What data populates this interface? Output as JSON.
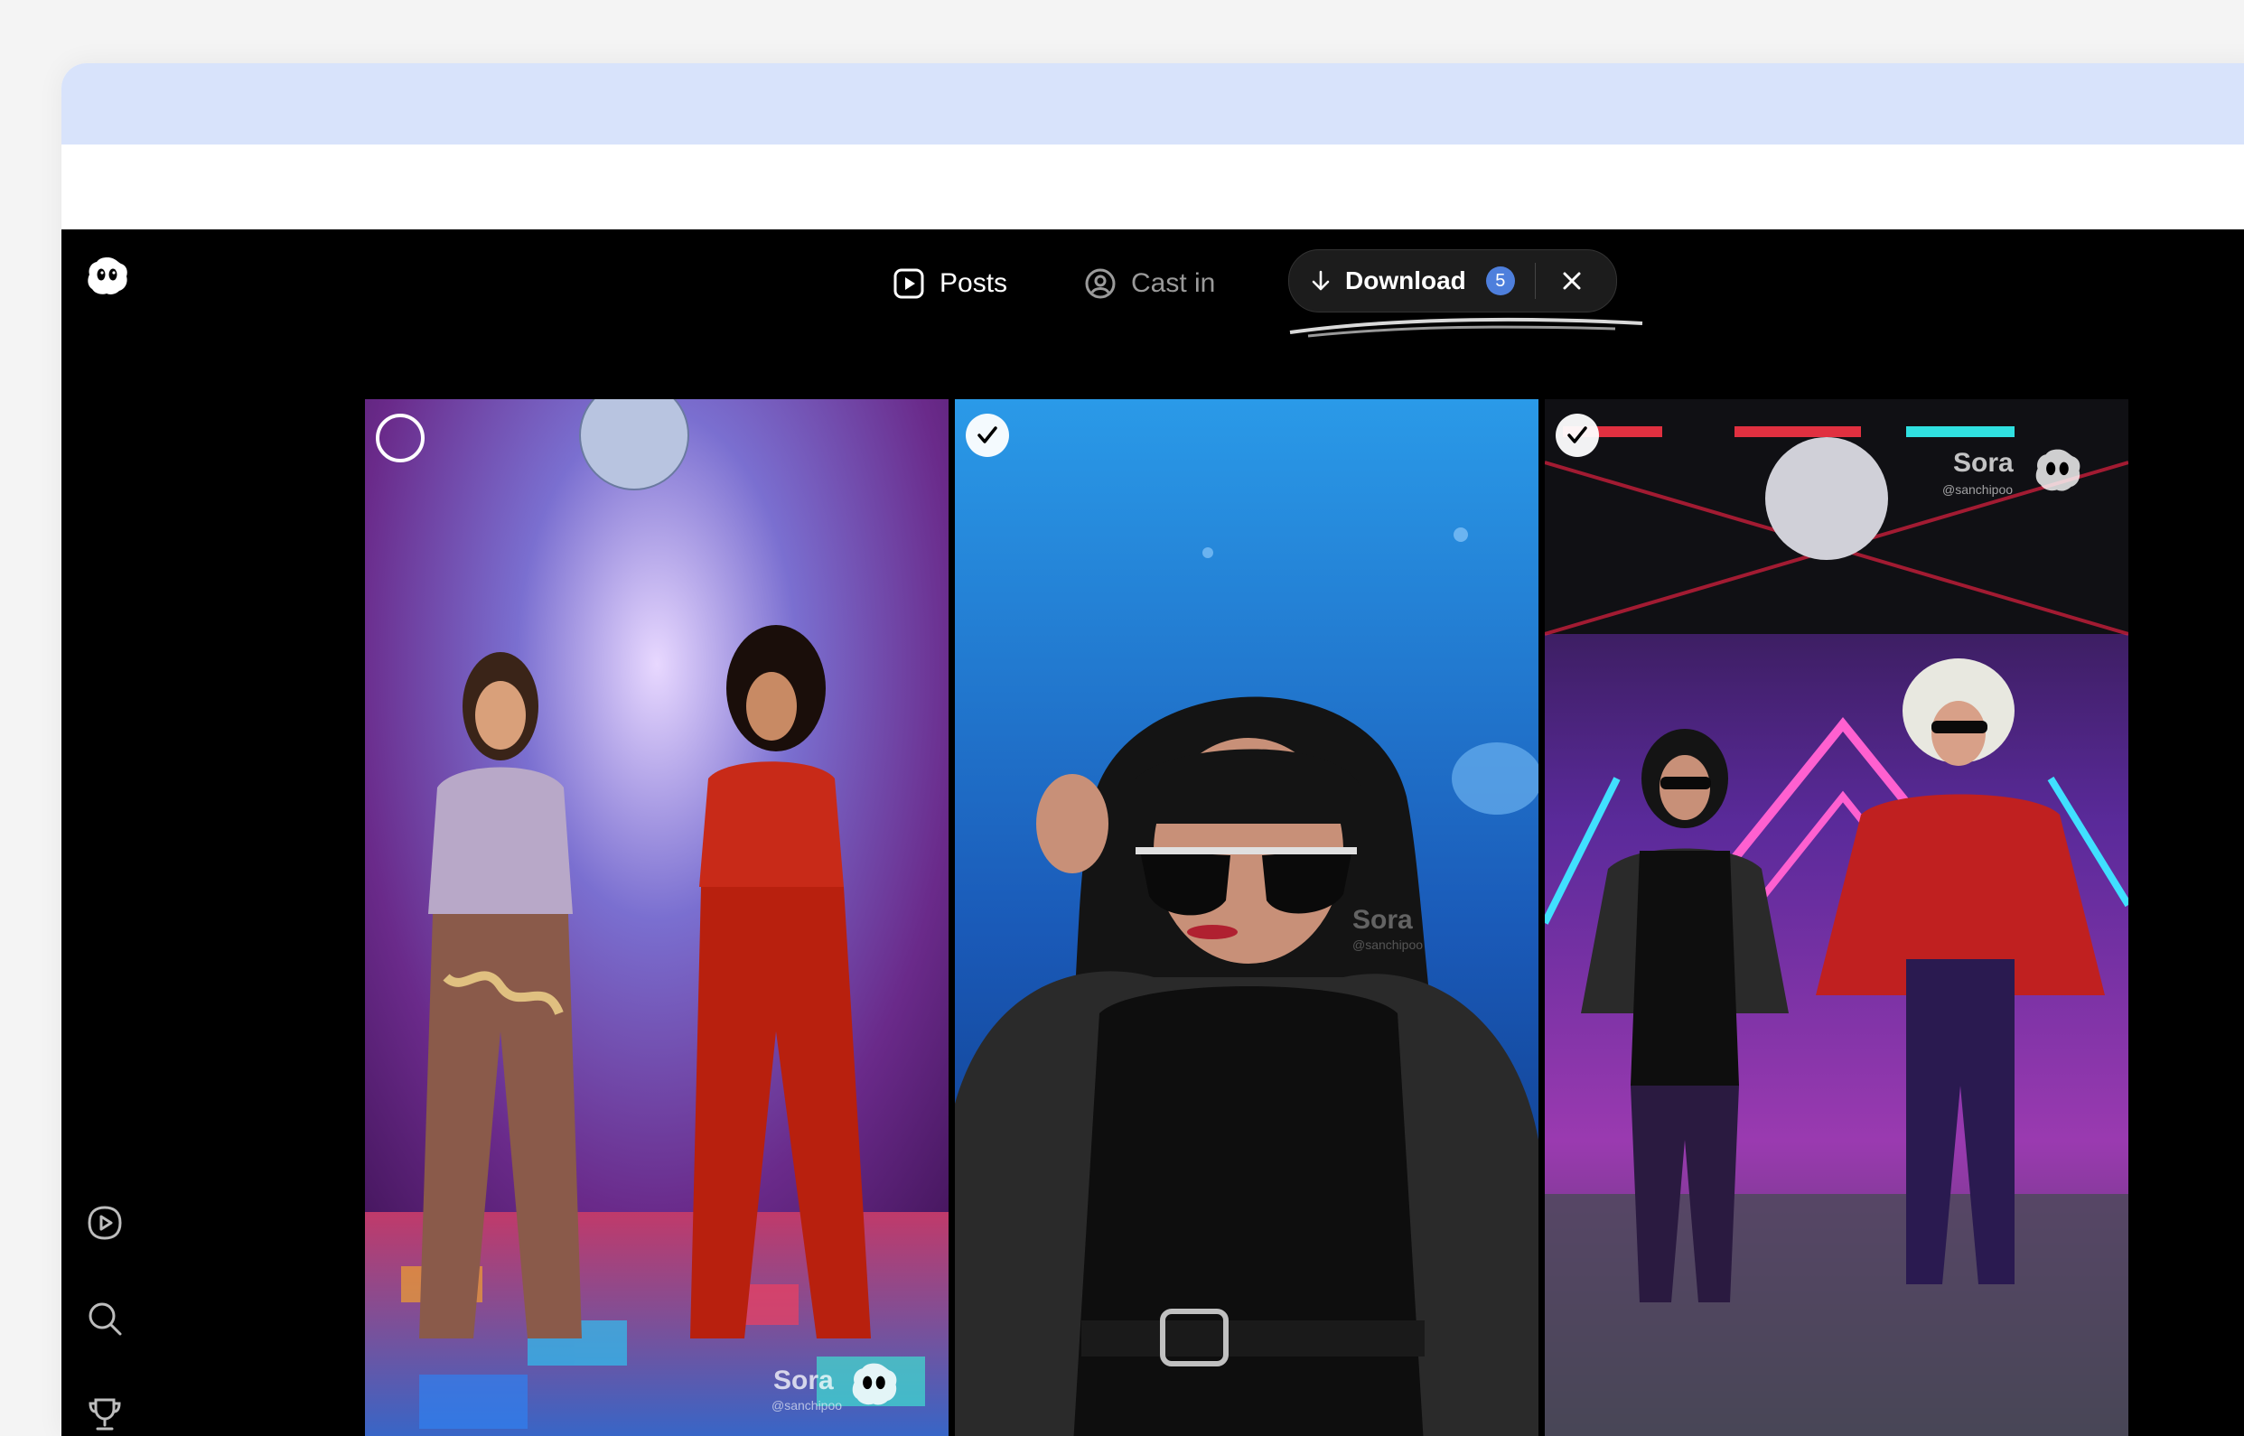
{
  "tabs": {
    "posts_label": "Posts",
    "cast_in_label": "Cast in"
  },
  "download": {
    "label": "Download",
    "count": "5"
  },
  "videos": [
    {
      "selected": false,
      "watermark": "Sora",
      "handle": "@sanchipoo"
    },
    {
      "selected": true,
      "watermark": "Sora",
      "handle": "@sanchipoo"
    },
    {
      "selected": true,
      "watermark": "Sora",
      "handle": "@sanchipoo"
    }
  ],
  "colors": {
    "accent_badge": "#4e7fdc",
    "app_bg": "#000000",
    "tabbar": "#d8e3fb",
    "inactive_tab": "#9a9a9a"
  },
  "icons": {
    "logo": "sora-logo-icon",
    "posts": "play-square-icon",
    "cast": "user-circle-icon",
    "download": "arrow-down-icon",
    "close": "close-icon",
    "side": [
      "play-icon",
      "search-icon",
      "trophy-icon"
    ]
  }
}
